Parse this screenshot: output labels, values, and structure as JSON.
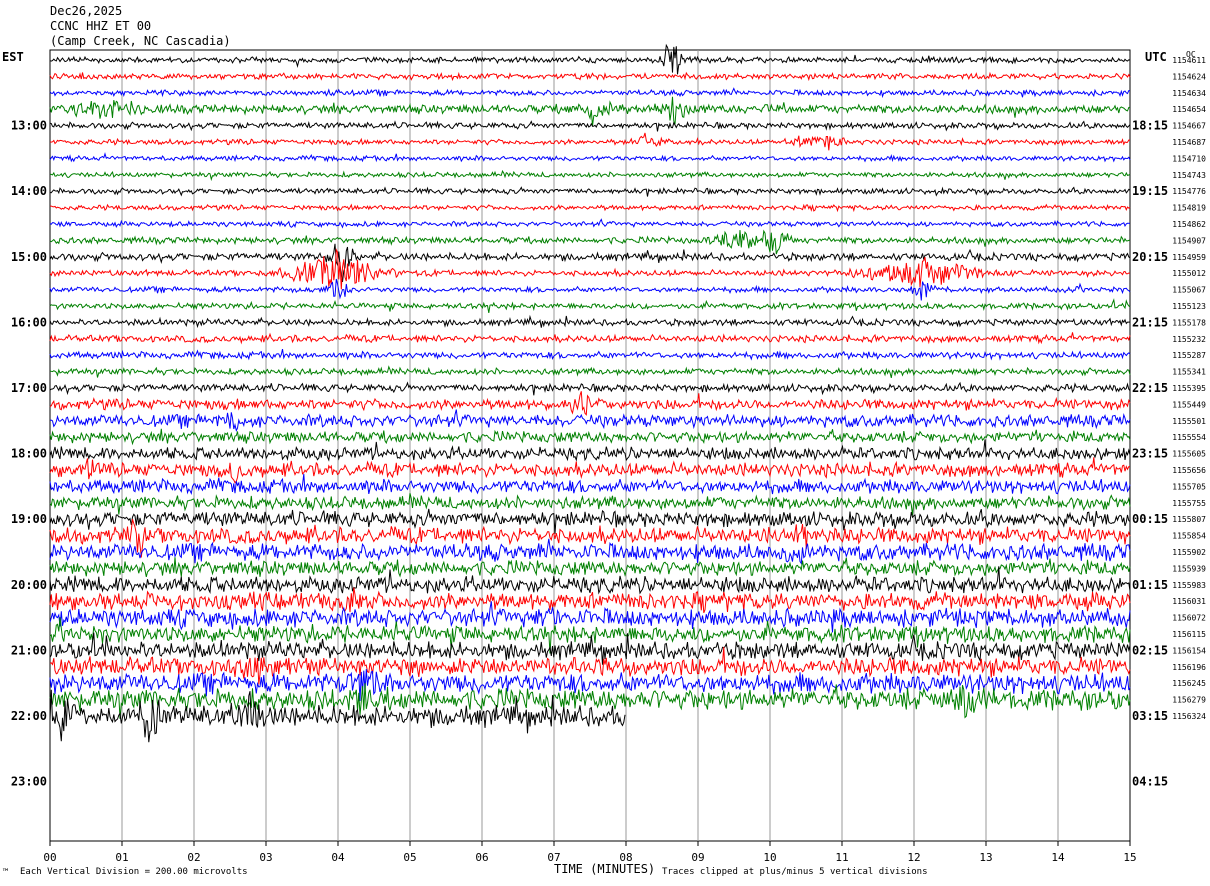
{
  "header": {
    "date": "Dec26,2025",
    "station": "CCNC HHZ ET 00",
    "location": "(Camp Creek, NC Cascadia)"
  },
  "left_tz": "EST",
  "right_tz": "UTC",
  "right_header": "OC",
  "footer": {
    "scale": "Each Vertical Division =  200.00 microvolts",
    "clip": "Traces clipped at plus/minus 5 vertical divisions",
    "corner": "™"
  },
  "chart_data": {
    "type": "line",
    "title": "",
    "xlabel": "TIME (MINUTES)",
    "ylabel": "",
    "x_ticks": [
      "00",
      "01",
      "02",
      "03",
      "04",
      "05",
      "06",
      "07",
      "08",
      "09",
      "10",
      "11",
      "12",
      "13",
      "14",
      "15"
    ],
    "xlim": [
      0,
      15
    ],
    "left_ticks": [
      "13:00",
      "14:00",
      "15:00",
      "16:00",
      "17:00",
      "18:00",
      "19:00",
      "20:00",
      "21:00",
      "22:00",
      "23:00"
    ],
    "right_ticks": [
      "18:15",
      "19:15",
      "20:15",
      "21:15",
      "22:15",
      "23:15",
      "00:15",
      "01:15",
      "02:15",
      "03:15",
      "04:15"
    ],
    "trace_colors": [
      "#000000",
      "#ff0000",
      "#0000ff",
      "#008000"
    ],
    "row_counts": [
      "1154611",
      "1154624",
      "1154634",
      "1154654",
      "1154667",
      "1154687",
      "1154710",
      "1154743",
      "1154776",
      "1154819",
      "1154862",
      "1154907",
      "1154959",
      "1155012",
      "1155067",
      "1155123",
      "1155178",
      "1155232",
      "1155287",
      "1155341",
      "1155395",
      "1155449",
      "1155501",
      "1155554",
      "1155605",
      "1155656",
      "1155705",
      "1155755",
      "1155807",
      "1155854",
      "1155902",
      "1155939",
      "1155983",
      "1156031",
      "1156072",
      "1156115",
      "1156154",
      "1156196",
      "1156245",
      "1156279",
      "1156324"
    ],
    "row_noise_levels": [
      2.2,
      2.3,
      2.2,
      3.5,
      2.4,
      2.1,
      2.0,
      2.0,
      2.2,
      2.0,
      2.0,
      2.6,
      3.0,
      2.4,
      2.2,
      2.4,
      2.6,
      2.8,
      2.7,
      2.6,
      3.0,
      4.2,
      5.0,
      4.5,
      5.0,
      5.5,
      5.5,
      5.2,
      6.0,
      6.5,
      6.8,
      6.0,
      6.5,
      7.0,
      7.2,
      6.8,
      7.0,
      7.5,
      8.0,
      8.5,
      8.5
    ],
    "last_row_end_minute": 8.0,
    "events": [
      {
        "row": 0,
        "minute": 8.65,
        "amplitude": 30,
        "duration": 0.25
      },
      {
        "row": 3,
        "minute": 8.65,
        "amplitude": 20,
        "duration": 0.3
      },
      {
        "row": 3,
        "minute": 0.8,
        "amplitude": 12,
        "duration": 0.8
      },
      {
        "row": 3,
        "minute": 7.6,
        "amplitude": 10,
        "duration": 0.5
      },
      {
        "row": 3,
        "minute": 10.05,
        "amplitude": 9,
        "duration": 0.3
      },
      {
        "row": 5,
        "minute": 8.3,
        "amplitude": 9,
        "duration": 0.35
      },
      {
        "row": 5,
        "minute": 10.7,
        "amplitude": 9,
        "duration": 0.6
      },
      {
        "row": 11,
        "minute": 10.05,
        "amplitude": 22,
        "duration": 0.35
      },
      {
        "row": 11,
        "minute": 9.6,
        "amplitude": 11,
        "duration": 0.8
      },
      {
        "row": 12,
        "minute": 4.05,
        "amplitude": 40,
        "duration": 0.25
      },
      {
        "row": 13,
        "minute": 4.0,
        "amplitude": 24,
        "duration": 1.2
      },
      {
        "row": 13,
        "minute": 12.1,
        "amplitude": 18,
        "duration": 1.4
      },
      {
        "row": 14,
        "minute": 4.0,
        "amplitude": 12,
        "duration": 0.3
      },
      {
        "row": 14,
        "minute": 12.1,
        "amplitude": 10,
        "duration": 0.3
      },
      {
        "row": 21,
        "minute": 7.4,
        "amplitude": 10,
        "duration": 0.4
      },
      {
        "row": 22,
        "minute": 2.55,
        "amplitude": 10,
        "duration": 0.25
      },
      {
        "row": 25,
        "minute": 0.55,
        "amplitude": 10,
        "duration": 0.2
      },
      {
        "row": 25,
        "minute": 2.6,
        "amplitude": 14,
        "duration": 0.2
      },
      {
        "row": 29,
        "minute": 1.2,
        "amplitude": 16,
        "duration": 0.25
      },
      {
        "row": 29,
        "minute": 10.4,
        "amplitude": 16,
        "duration": 0.3
      },
      {
        "row": 30,
        "minute": 10.4,
        "amplitude": 12,
        "duration": 0.25
      },
      {
        "row": 33,
        "minute": 4.2,
        "amplitude": 12,
        "duration": 0.3
      },
      {
        "row": 34,
        "minute": 6.9,
        "amplitude": 14,
        "duration": 0.3
      },
      {
        "row": 37,
        "minute": 2.9,
        "amplitude": 12,
        "duration": 0.4
      },
      {
        "row": 38,
        "minute": 4.3,
        "amplitude": 16,
        "duration": 0.4
      },
      {
        "row": 39,
        "minute": 4.3,
        "amplitude": 18,
        "duration": 0.3
      },
      {
        "row": 39,
        "minute": 12.8,
        "amplitude": 14,
        "duration": 0.5
      },
      {
        "row": 40,
        "minute": 1.4,
        "amplitude": 38,
        "duration": 0.25
      },
      {
        "row": 40,
        "minute": 2.8,
        "amplitude": 32,
        "duration": 0.2
      },
      {
        "row": 40,
        "minute": 0.2,
        "amplitude": 18,
        "duration": 0.3
      }
    ]
  }
}
